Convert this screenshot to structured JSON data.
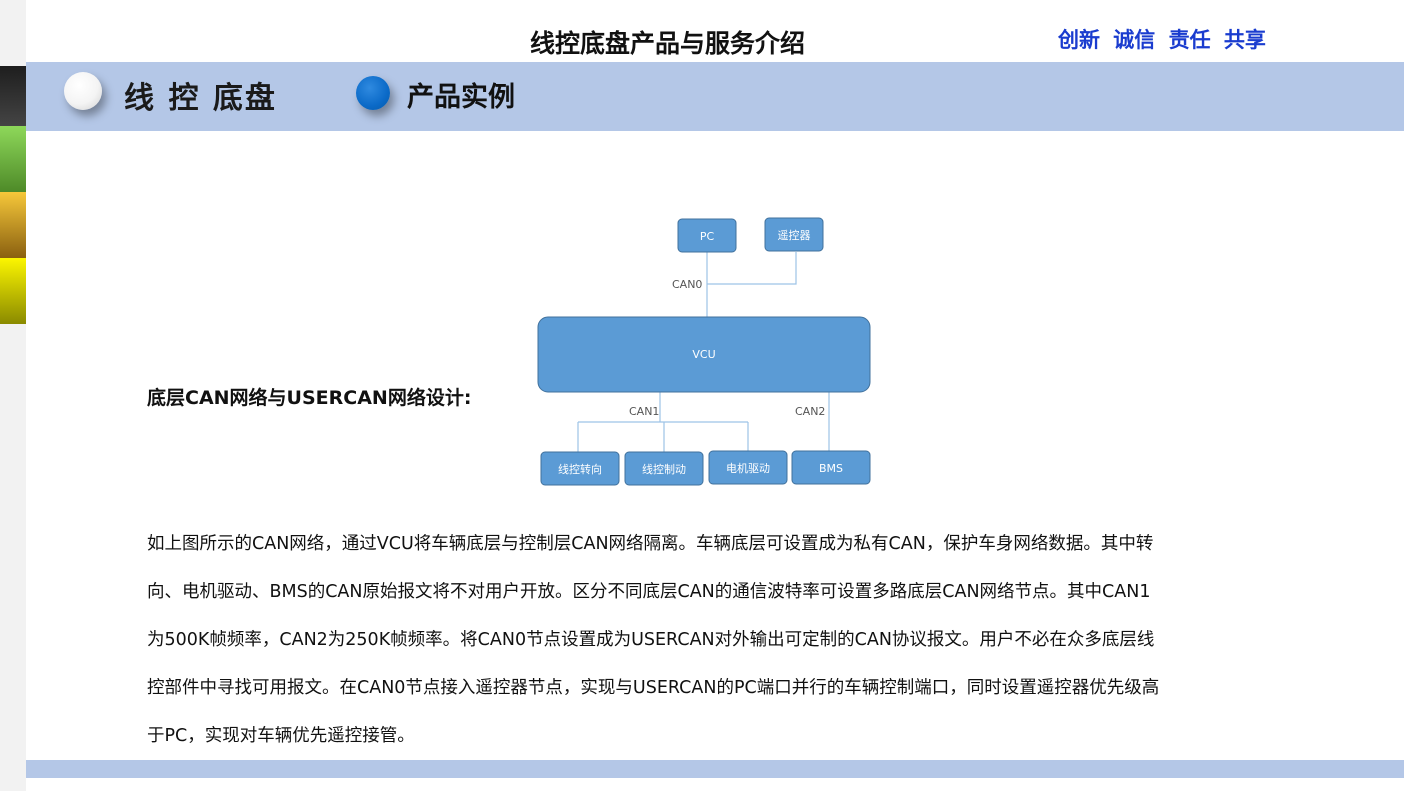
{
  "header": {
    "title": "线控底盘产品与服务介绍",
    "motto": "创新 诚信 责任 共享"
  },
  "banner": {
    "title": "线 控 底盘",
    "subtitle": "产品实例"
  },
  "section": {
    "label": "底层CAN网络与USERCAN网络设计:"
  },
  "diagram": {
    "nodes": {
      "pc": "PC",
      "remote": "遥控器",
      "vcu": "VCU",
      "steer": "线控转向",
      "brake": "线控制动",
      "motor": "电机驱动",
      "bms": "BMS"
    },
    "buses": {
      "can0": "CAN0",
      "can1": "CAN1",
      "can2": "CAN2"
    },
    "colors": {
      "node_fill": "#5b9bd5",
      "node_stroke": "#41719c",
      "line": "#9dc3e6"
    }
  },
  "description": {
    "lines": [
      "如上图所示的CAN网络，通过VCU将车辆底层与控制层CAN网络隔离。车辆底层可设置成为私有CAN，保护车身网络数据。其中转",
      "向、电机驱动、BMS的CAN原始报文将不对用户开放。区分不同底层CAN的通信波特率可设置多路底层CAN网络节点。其中CAN1",
      "为500K帧频率，CAN2为250K帧频率。将CAN0节点设置成为USERCAN对外输出可定制的CAN协议报文。用户不必在众多底层线",
      "控部件中寻找可用报文。在CAN0节点接入遥控器节点，实现与USERCAN的PC端口并行的车辆控制端口，同时设置遥控器优先级高",
      "于PC，实现对车辆优先遥控接管。"
    ]
  },
  "theme": {
    "banner_color": "#b4c7e7",
    "motto_color": "#1a3ccf",
    "orb_blue": "#0b6ac8"
  }
}
